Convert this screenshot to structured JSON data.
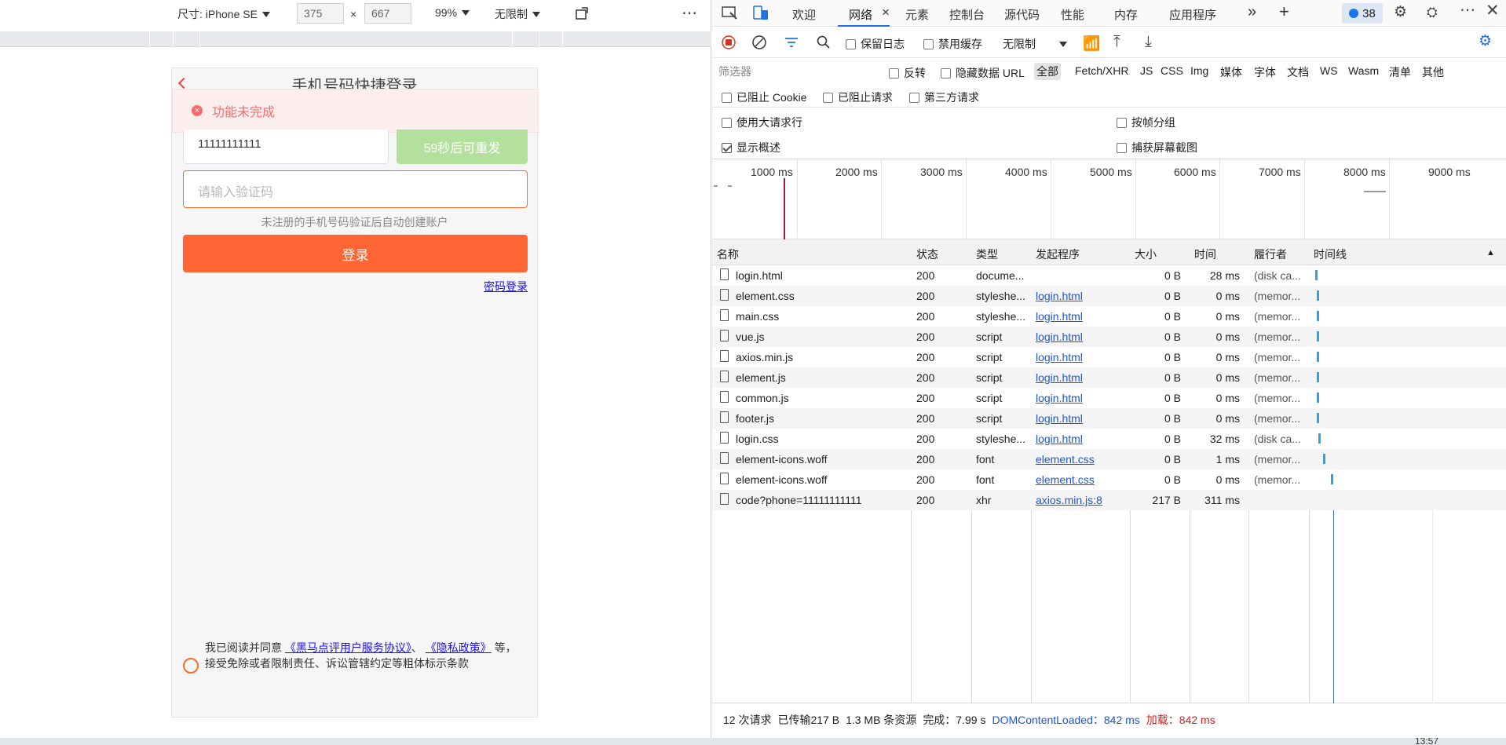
{
  "device_toolbar": {
    "device": "尺寸: iPhone SE",
    "width": "375",
    "times": "×",
    "height": "667",
    "zoom": "99%",
    "throttle": "无限制"
  },
  "phone_page": {
    "title": "手机号码快捷登录",
    "toast": "功能未完成",
    "phone_value": "11111111111",
    "resend_label": "59秒后可重发",
    "code_placeholder": "请输入验证码",
    "hint": "未注册的手机号码验证后自动创建账户",
    "login_label": "登录",
    "password_login": "密码登录",
    "agree_prefix": "我已阅读并同意",
    "agree_link1": "《黑马点评用户服务协议》",
    "agree_sep": "、",
    "agree_link2": "《隐私政策》",
    "agree_suffix": "等，接受免除或者限制责任、诉讼管辖约定等粗体标示条款"
  },
  "devtools": {
    "tabs": [
      "欢迎",
      "网络",
      "元素",
      "控制台",
      "源代码",
      "性能",
      "内存",
      "应用程序"
    ],
    "issues_count": "38",
    "toolbar": {
      "preserve_log": "保留日志",
      "disable_cache": "禁用缓存",
      "throttle": "无限制"
    },
    "filter": {
      "placeholder": "筛选器",
      "invert": "反转",
      "hide_data_urls": "隐藏数据 URL",
      "types": [
        "全部",
        "Fetch/XHR",
        "JS",
        "CSS",
        "Img",
        "媒体",
        "字体",
        "文档",
        "WS",
        "Wasm",
        "清单",
        "其他"
      ],
      "blocked_cookies": "已阻止 Cookie",
      "blocked_requests": "已阻止请求",
      "third_party": "第三方请求"
    },
    "options": {
      "big_rows": "使用大请求行",
      "group_by_frame": "按帧分组",
      "show_overview": "显示概述",
      "capture_screenshots": "捕获屏幕截图"
    },
    "timeline_ticks": [
      "1000 ms",
      "2000 ms",
      "3000 ms",
      "4000 ms",
      "5000 ms",
      "6000 ms",
      "7000 ms",
      "8000 ms",
      "9000 ms"
    ],
    "columns": [
      "名称",
      "状态",
      "类型",
      "发起程序",
      "大小",
      "时间",
      "履行者",
      "时间线"
    ],
    "rows": [
      {
        "name": "login.html",
        "status": "200",
        "type": "docume...",
        "initiator": "",
        "size": "0 B",
        "time": "28 ms",
        "fulfilled": "(disk ca..."
      },
      {
        "name": "element.css",
        "status": "200",
        "type": "styleshe...",
        "initiator": "login.html",
        "size": "0 B",
        "time": "0 ms",
        "fulfilled": "(memor..."
      },
      {
        "name": "main.css",
        "status": "200",
        "type": "styleshe...",
        "initiator": "login.html",
        "size": "0 B",
        "time": "0 ms",
        "fulfilled": "(memor..."
      },
      {
        "name": "vue.js",
        "status": "200",
        "type": "script",
        "initiator": "login.html",
        "size": "0 B",
        "time": "0 ms",
        "fulfilled": "(memor..."
      },
      {
        "name": "axios.min.js",
        "status": "200",
        "type": "script",
        "initiator": "login.html",
        "size": "0 B",
        "time": "0 ms",
        "fulfilled": "(memor..."
      },
      {
        "name": "element.js",
        "status": "200",
        "type": "script",
        "initiator": "login.html",
        "size": "0 B",
        "time": "0 ms",
        "fulfilled": "(memor..."
      },
      {
        "name": "common.js",
        "status": "200",
        "type": "script",
        "initiator": "login.html",
        "size": "0 B",
        "time": "0 ms",
        "fulfilled": "(memor..."
      },
      {
        "name": "footer.js",
        "status": "200",
        "type": "script",
        "initiator": "login.html",
        "size": "0 B",
        "time": "0 ms",
        "fulfilled": "(memor..."
      },
      {
        "name": "login.css",
        "status": "200",
        "type": "styleshe...",
        "initiator": "login.html",
        "size": "0 B",
        "time": "32 ms",
        "fulfilled": "(disk ca..."
      },
      {
        "name": "element-icons.woff",
        "status": "200",
        "type": "font",
        "initiator": "element.css",
        "size": "0 B",
        "time": "1 ms",
        "fulfilled": "(memor..."
      },
      {
        "name": "element-icons.woff",
        "status": "200",
        "type": "font",
        "initiator": "element.css",
        "size": "0 B",
        "time": "0 ms",
        "fulfilled": "(memor..."
      },
      {
        "name": "code?phone=11111111111",
        "status": "200",
        "type": "xhr",
        "initiator": "axios.min.js:8",
        "size": "217 B",
        "time": "311 ms",
        "fulfilled": ""
      }
    ],
    "status_bar": {
      "requests": "12 次请求",
      "transferred": "已传输217 B",
      "resources": "1.3 MB 条资源",
      "finish": "完成：7.99 s",
      "dcl": "DOMContentLoaded：842 ms",
      "load": "加载：842 ms"
    }
  },
  "taskbar": {
    "clock": "13:57"
  },
  "colors": {
    "accent": "#ff6633",
    "devtools_blue": "#1a73e8",
    "error_red": "#f56c6c",
    "resend_green": "#b3e19d"
  }
}
